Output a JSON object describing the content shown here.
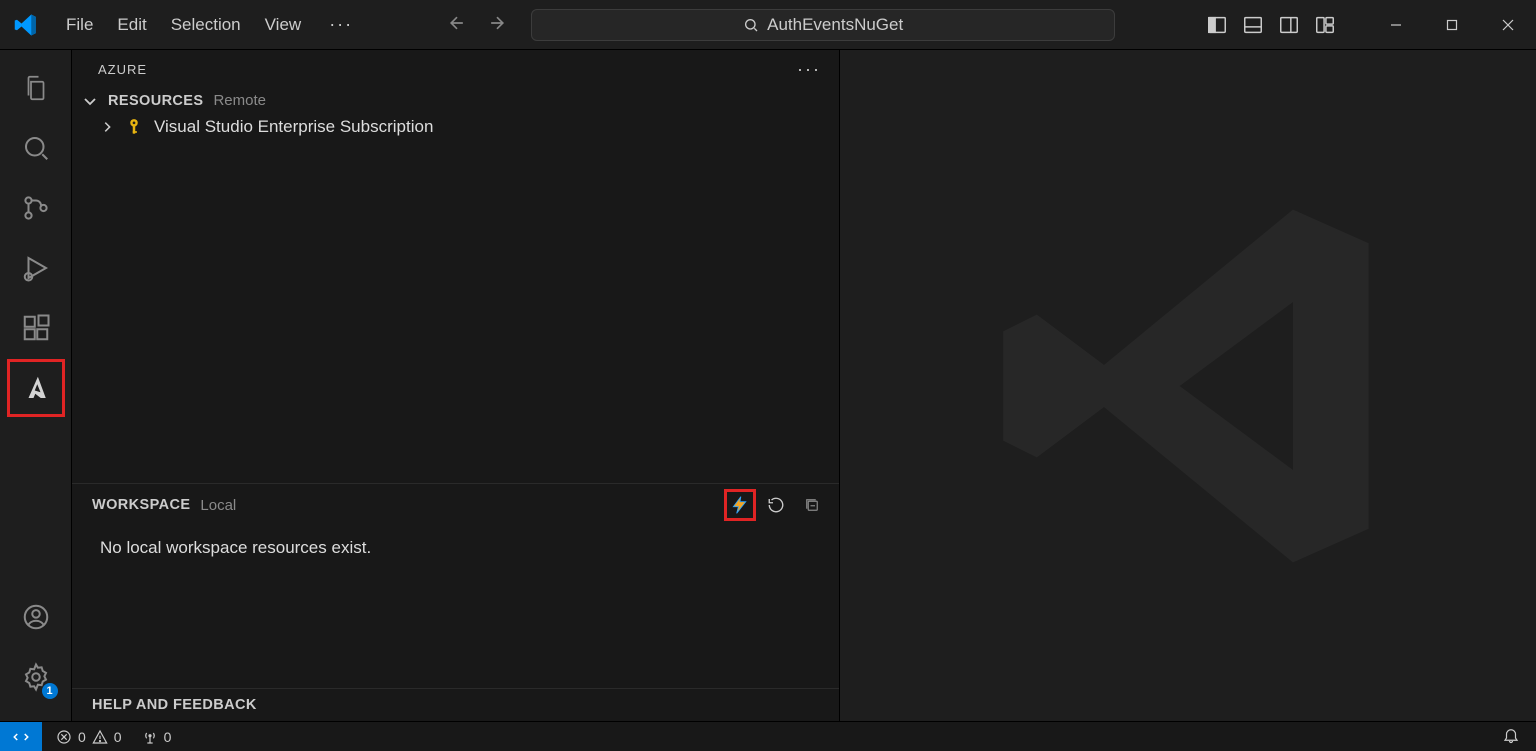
{
  "menu": {
    "file": "File",
    "edit": "Edit",
    "selection": "Selection",
    "view": "View",
    "more": "···"
  },
  "search": {
    "text": "AuthEventsNuGet"
  },
  "sidebar": {
    "title": "AZURE",
    "resources": {
      "title": "RESOURCES",
      "sub": "Remote"
    },
    "resource_item": "Visual Studio Enterprise Subscription",
    "workspace": {
      "title": "WORKSPACE",
      "sub": "Local",
      "message": "No local workspace resources exist."
    },
    "help": {
      "title": "HELP AND FEEDBACK"
    }
  },
  "status": {
    "errors": "0",
    "warnings": "0",
    "ports": "0"
  },
  "activity": {
    "settings_badge": "1"
  }
}
